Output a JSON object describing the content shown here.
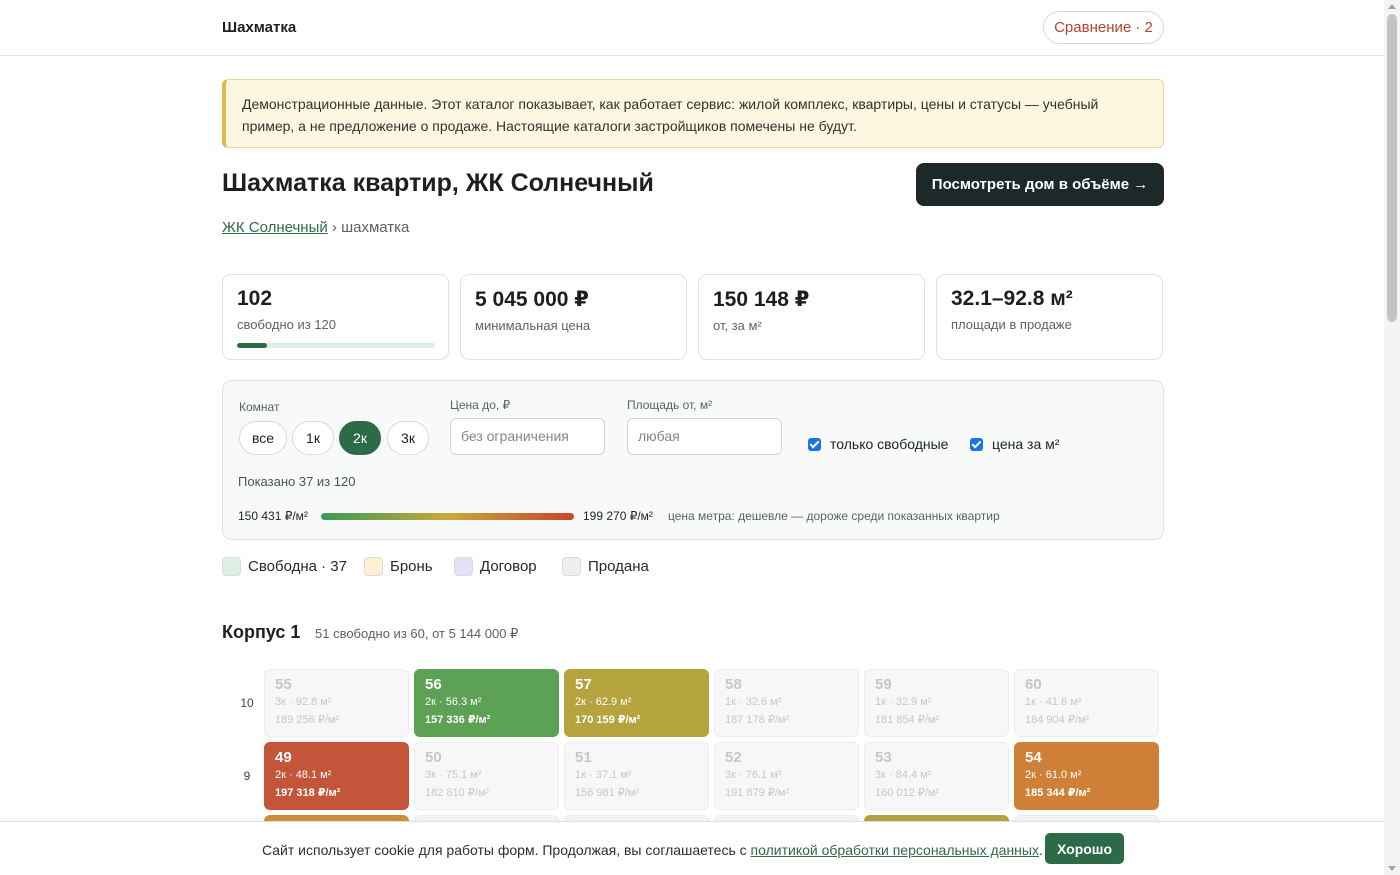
{
  "header": {
    "brand": "Шахматка",
    "compare_label": "Сравнение · 2"
  },
  "notice": "Демонстрационные данные. Этот каталог показывает, как работает сервис: жилой комплекс, квартиры, цены и статусы — учебный пример, а не предложение о продаже. Настоящие каталоги застройщиков помечены не будут.",
  "page": {
    "title": "Шахматка квартир, ЖК Солнечный",
    "view3d_label": "Посмотреть дом в объёме →"
  },
  "breadcrumb": {
    "link": "ЖК Солнечный",
    "sep": " › ",
    "current": "шахматка"
  },
  "stats": [
    {
      "value": "102",
      "label": "свободно из 120",
      "progress": 0.15
    },
    {
      "value": "5 045 000 ₽",
      "label": "минимальная цена"
    },
    {
      "value": "150 148 ₽",
      "label": "от, за м²"
    },
    {
      "value": "32.1–92.8 м²",
      "label": "площади в продаже"
    }
  ],
  "filters": {
    "rooms_label": "Комнат",
    "rooms": [
      "все",
      "1к",
      "2к",
      "3к"
    ],
    "rooms_selected": "2к",
    "price_label": "Цена до, ₽",
    "price_placeholder": "без ограничения",
    "area_label": "Площадь от, м²",
    "area_placeholder": "любая",
    "only_free_label": "только свободные",
    "only_free_checked": true,
    "ppm_label": "цена за м²",
    "ppm_checked": true,
    "shown": "Показано 37 из 120",
    "grad_min": "150 431 ₽/м²",
    "grad_max": "199 270 ₽/м²",
    "grad_caption": "цена метра: дешевле — дороже среди показанных квартир",
    "grad_colors": [
      "#3c9a57",
      "#c9a83a",
      "#c8452c"
    ]
  },
  "legend": [
    {
      "label": "Свободна · 37",
      "color": "#dcefe3"
    },
    {
      "label": "Бронь",
      "color": "#fdf1d2"
    },
    {
      "label": "Договор",
      "color": "#e2e3fb"
    },
    {
      "label": "Продана",
      "color": "#eeeff0"
    }
  ],
  "korpus": {
    "title": "Корпус 1",
    "subtitle": "51 свободно из 60, от 5 144 000 ₽",
    "floors": [
      {
        "floor": "10",
        "cells": [
          {
            "num": "55",
            "det": "3к · 92.8 м²",
            "ppm": "189 256 ₽/м²",
            "color": null
          },
          {
            "num": "56",
            "det": "2к · 56.3 м²",
            "ppm": "157 336 ₽/м²",
            "color": "#5da155"
          },
          {
            "num": "57",
            "det": "2к · 62.9 м²",
            "ppm": "170 159 ₽/м²",
            "color": "#b5a33e"
          },
          {
            "num": "58",
            "det": "1к · 32.6 м²",
            "ppm": "187 178 ₽/м²",
            "color": null
          },
          {
            "num": "59",
            "det": "1к · 32.9 м²",
            "ppm": "181 854 ₽/м²",
            "color": null
          },
          {
            "num": "60",
            "det": "1к · 41.8 м²",
            "ppm": "184 904 ₽/м²",
            "color": null
          }
        ]
      },
      {
        "floor": "9",
        "cells": [
          {
            "num": "49",
            "det": "2к · 48.1 м²",
            "ppm": "197 318 ₽/м²",
            "color": "#c4543a"
          },
          {
            "num": "50",
            "det": "3к · 75.1 м²",
            "ppm": "182 810 ₽/м²",
            "color": null
          },
          {
            "num": "51",
            "det": "1к · 37.1 м²",
            "ppm": "156 981 ₽/м²",
            "color": null
          },
          {
            "num": "52",
            "det": "3к · 76.1 м²",
            "ppm": "191 879 ₽/м²",
            "color": null
          },
          {
            "num": "53",
            "det": "3к · 84.4 м²",
            "ppm": "160 012 ₽/м²",
            "color": null
          },
          {
            "num": "54",
            "det": "2к · 61.0 м²",
            "ppm": "185 344 ₽/м²",
            "color": "#cf8038"
          }
        ]
      },
      {
        "floor": "",
        "cells": [
          {
            "num": "",
            "det": "",
            "ppm": "",
            "color": "#cf9038"
          },
          {
            "num": "",
            "det": "",
            "ppm": "",
            "color": null
          },
          {
            "num": "",
            "det": "",
            "ppm": "",
            "color": null
          },
          {
            "num": "",
            "det": "",
            "ppm": "",
            "color": null
          },
          {
            "num": "",
            "det": "",
            "ppm": "",
            "color": "#b5a33e"
          },
          {
            "num": "",
            "det": "",
            "ppm": "",
            "color": null
          }
        ]
      }
    ]
  },
  "cookie": {
    "text_before": "Сайт использует cookie для работы форм. Продолжая, вы соглашаетесь с ",
    "link": "политикой обработки персональных данных",
    "text_after": ".",
    "button": "Хорошо"
  }
}
